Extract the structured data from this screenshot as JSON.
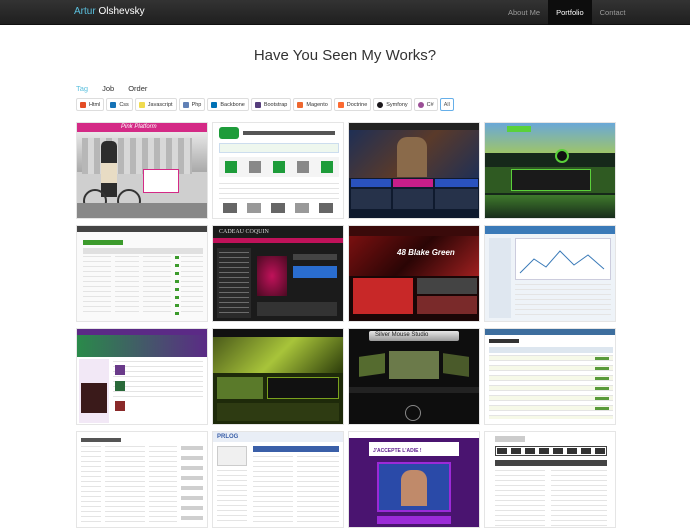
{
  "navbar": {
    "brand_first": "Artur",
    "brand_last": "Olshevsky",
    "links": [
      {
        "label": "About Me",
        "active": false
      },
      {
        "label": "Portfolio",
        "active": true
      },
      {
        "label": "Contact",
        "active": false
      }
    ]
  },
  "page_title": "Have You Seen My Works?",
  "tabs": [
    {
      "label": "Tag",
      "active": true
    },
    {
      "label": "Job",
      "active": false
    },
    {
      "label": "Order",
      "active": false
    }
  ],
  "filters": [
    {
      "label": "Html",
      "icon": "html5-icon",
      "color": "#e44d26"
    },
    {
      "label": "Css",
      "icon": "css3-icon",
      "color": "#1572b6"
    },
    {
      "label": "Javascript",
      "icon": "js-icon",
      "color": "#f0db4f"
    },
    {
      "label": "Php",
      "icon": "php-icon",
      "color": "#6181b6"
    },
    {
      "label": "Backbone",
      "icon": "backbone-icon",
      "color": "#0071b5"
    },
    {
      "label": "Bootstrap",
      "icon": "bootstrap-icon",
      "color": "#563d7c"
    },
    {
      "label": "Magento",
      "icon": "magento-icon",
      "color": "#ee672f"
    },
    {
      "label": "Doctrine",
      "icon": "doctrine-icon",
      "color": "#fc6a31"
    },
    {
      "label": "Symfony",
      "icon": "symfony-icon",
      "color": "#1a171b"
    },
    {
      "label": "C#",
      "icon": "csharp-icon",
      "color": "#9b4f96"
    },
    {
      "label": "All",
      "icon": "",
      "color": "",
      "active": true
    }
  ],
  "thumbnails": [
    {
      "name": "Pink Platform",
      "bg": "#c9c9c9",
      "accent": "#d42a86"
    },
    {
      "name": "",
      "bg": "#ffffff",
      "accent": "#1e9c3a"
    },
    {
      "name": "",
      "bg": "#1a2a4a",
      "accent": "#2255cc"
    },
    {
      "name": "",
      "bg": "#1e3a1e",
      "accent": "#5ad13a"
    },
    {
      "name": "",
      "bg": "#f5f5f5",
      "accent": "#3c9b2c"
    },
    {
      "name": "CADEAU COQUIN",
      "bg": "#1b1b1b",
      "accent": "#c0125a"
    },
    {
      "name": "48 Blake Green",
      "bg": "#2a0a0a",
      "accent": "#b61c1c"
    },
    {
      "name": "",
      "bg": "#eef3f8",
      "accent": "#3a7ab8"
    },
    {
      "name": "",
      "bg": "#ffffff",
      "accent": "#5b2a86"
    },
    {
      "name": "",
      "bg": "#2e3b12",
      "accent": "#7aa11e"
    },
    {
      "name": "Silver Mouse Studio",
      "bg": "#121212",
      "accent": "#888888"
    },
    {
      "name": "",
      "bg": "#ffffff",
      "accent": "#3d6e9e"
    },
    {
      "name": "",
      "bg": "#ffffff",
      "accent": "#999999"
    },
    {
      "name": "PRLOG",
      "bg": "#ffffff",
      "accent": "#3a5fa8"
    },
    {
      "name": "J'ACCEPTE L'ADIE !",
      "bg": "#5b1a8c",
      "accent": "#9c2ad8"
    },
    {
      "name": "",
      "bg": "#ffffff",
      "accent": "#444444"
    }
  ]
}
